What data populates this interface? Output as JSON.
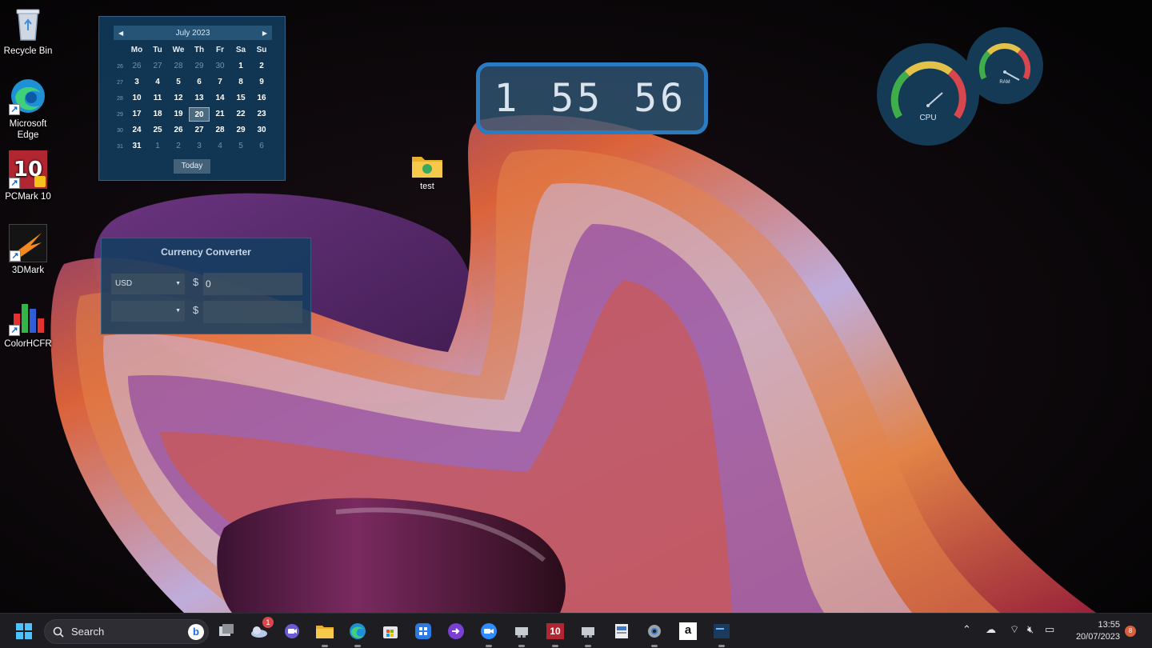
{
  "desktop_icons": [
    {
      "name": "recycle-bin",
      "label": "Recycle Bin"
    },
    {
      "name": "microsoft-edge",
      "label": "Microsoft Edge"
    },
    {
      "name": "pcmark-10",
      "label": "PCMark 10"
    },
    {
      "name": "3dmark",
      "label": "3DMark"
    },
    {
      "name": "colorhcfr",
      "label": "ColorHCFR"
    }
  ],
  "test_folder": {
    "label": "test"
  },
  "calendar": {
    "month_label": "July 2023",
    "days_of_week": [
      "Mo",
      "Tu",
      "We",
      "Th",
      "Fr",
      "Sa",
      "Su"
    ],
    "weeks": [
      {
        "wk": "26",
        "days": [
          "26",
          "27",
          "28",
          "29",
          "30",
          "1",
          "2"
        ]
      },
      {
        "wk": "27",
        "days": [
          "3",
          "4",
          "5",
          "6",
          "7",
          "8",
          "9"
        ]
      },
      {
        "wk": "28",
        "days": [
          "10",
          "11",
          "12",
          "13",
          "14",
          "15",
          "16"
        ]
      },
      {
        "wk": "29",
        "days": [
          "17",
          "18",
          "19",
          "20",
          "21",
          "22",
          "23"
        ]
      },
      {
        "wk": "30",
        "days": [
          "24",
          "25",
          "26",
          "27",
          "28",
          "29",
          "30"
        ]
      },
      {
        "wk": "31",
        "days": [
          "31",
          "1",
          "2",
          "3",
          "4",
          "5",
          "6"
        ]
      }
    ],
    "today_label": "Today",
    "selected_day": "20"
  },
  "clock_widget": {
    "hours": "1",
    "minutes": "55",
    "seconds": "56"
  },
  "gauges": {
    "cpu_label": "CPU",
    "ram_label": "RAM",
    "colors": {
      "green": "#3fae4a",
      "yellow": "#e3c24a",
      "red": "#d9474e",
      "face": "#143a56"
    }
  },
  "currency_converter": {
    "title": "Currency Converter",
    "from_currency": "USD",
    "to_currency": "",
    "symbol_from": "$",
    "symbol_to": "$",
    "amount_from": "0",
    "amount_to": ""
  },
  "taskbar": {
    "search_placeholder": "Search",
    "bing_label": "b",
    "weather_badge": "1",
    "pcmark_label": "10",
    "amazon_label": "a",
    "time": "13:55",
    "date": "20/07/2023",
    "notification_count": "8"
  }
}
